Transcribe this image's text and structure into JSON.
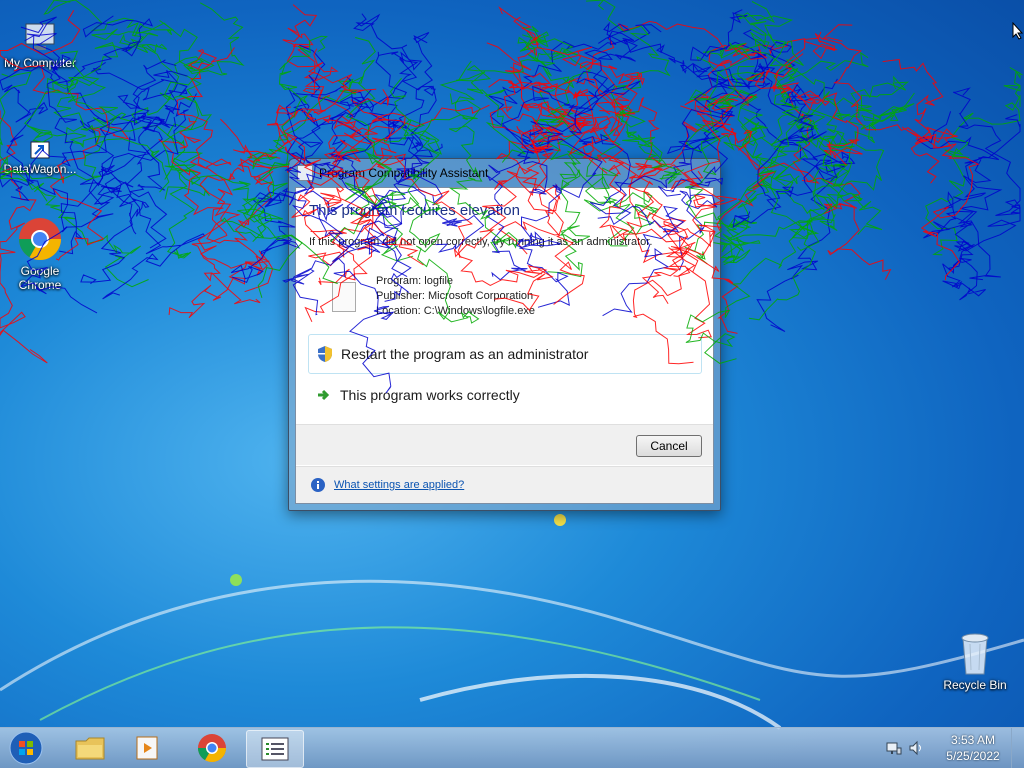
{
  "desktop": {
    "icons": [
      {
        "label": "My Computer",
        "icon": "computer-icon"
      },
      {
        "label": "DataWagon...",
        "icon": "shortcut-icon"
      },
      {
        "label": "Google Chrome",
        "icon": "chrome-icon"
      },
      {
        "label": "Recycle Bin",
        "icon": "recycle-bin-icon"
      }
    ]
  },
  "dialog": {
    "title": "Program Compatibility Assistant",
    "heading": "This program requires elevation",
    "description": "If this program did not open correctly, try running it as an administrator.",
    "details": {
      "program": "Program: logfile",
      "publisher": "Publisher: Microsoft Corporation",
      "location": "Location: C:\\Windows\\logfile.exe"
    },
    "command_restart": "Restart the program as an administrator",
    "command_works": "This program works correctly",
    "cancel_label": "Cancel",
    "info_link": "What settings are applied?"
  },
  "taskbar": {
    "pinned": [
      {
        "name": "explorer",
        "icon": "folder-icon"
      },
      {
        "name": "media-player",
        "icon": "media-player-icon"
      },
      {
        "name": "chrome",
        "icon": "chrome-icon"
      },
      {
        "name": "active-window",
        "icon": "list-icon"
      }
    ],
    "time": "3:53 AM",
    "date": "5/25/2022"
  },
  "colors": {
    "heading": "#1e3287",
    "link": "#0b54b1",
    "scribble": [
      "#ff0000",
      "#00aa00",
      "#0000cc"
    ]
  }
}
